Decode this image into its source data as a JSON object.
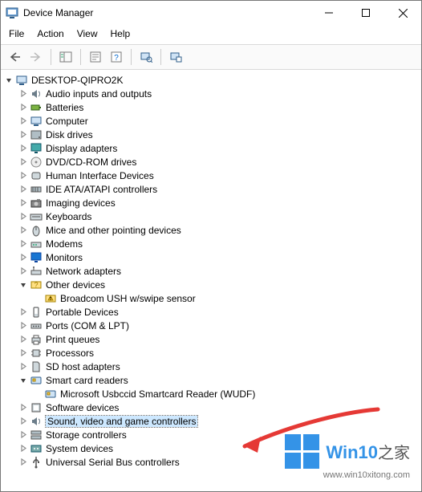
{
  "window": {
    "title": "Device Manager"
  },
  "menu": {
    "file": "File",
    "action": "Action",
    "view": "View",
    "help": "Help"
  },
  "root": {
    "label": "DESKTOP-QIPRO2K"
  },
  "items": [
    {
      "label": "Audio inputs and outputs",
      "icon": "speaker"
    },
    {
      "label": "Batteries",
      "icon": "battery"
    },
    {
      "label": "Computer",
      "icon": "computer"
    },
    {
      "label": "Disk drives",
      "icon": "disk"
    },
    {
      "label": "Display adapters",
      "icon": "display"
    },
    {
      "label": "DVD/CD-ROM drives",
      "icon": "dvd"
    },
    {
      "label": "Human Interface Devices",
      "icon": "hid"
    },
    {
      "label": "IDE ATA/ATAPI controllers",
      "icon": "ide"
    },
    {
      "label": "Imaging devices",
      "icon": "camera"
    },
    {
      "label": "Keyboards",
      "icon": "keyboard"
    },
    {
      "label": "Mice and other pointing devices",
      "icon": "mouse"
    },
    {
      "label": "Modems",
      "icon": "modem"
    },
    {
      "label": "Monitors",
      "icon": "monitor"
    },
    {
      "label": "Network adapters",
      "icon": "network"
    },
    {
      "label": "Other devices",
      "icon": "other",
      "expanded": true,
      "children": [
        {
          "label": "Broadcom USH w/swipe sensor",
          "icon": "warn"
        }
      ]
    },
    {
      "label": "Portable Devices",
      "icon": "portable"
    },
    {
      "label": "Ports (COM & LPT)",
      "icon": "port"
    },
    {
      "label": "Print queues",
      "icon": "printer"
    },
    {
      "label": "Processors",
      "icon": "cpu"
    },
    {
      "label": "SD host adapters",
      "icon": "sd"
    },
    {
      "label": "Smart card readers",
      "icon": "smartcard",
      "expanded": true,
      "children": [
        {
          "label": "Microsoft Usbccid Smartcard Reader (WUDF)",
          "icon": "smartcard"
        }
      ]
    },
    {
      "label": "Software devices",
      "icon": "software"
    },
    {
      "label": "Sound, video and game controllers",
      "icon": "speaker",
      "selected": true
    },
    {
      "label": "Storage controllers",
      "icon": "storage"
    },
    {
      "label": "System devices",
      "icon": "system"
    },
    {
      "label": "Universal Serial Bus controllers",
      "icon": "usb"
    }
  ],
  "watermark": {
    "brand_main": "Win10",
    "brand_sub": "之家",
    "url": "www.win10xitong.com"
  },
  "colors": {
    "selection": "#cde8ff",
    "arrow_red": "#e53935",
    "brand_blue": "#1e88e5"
  }
}
